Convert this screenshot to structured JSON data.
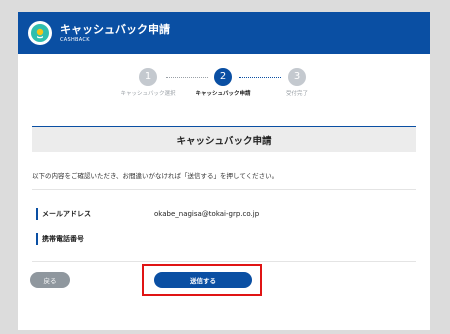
{
  "header": {
    "title": "キャッシュバック申請",
    "subtitle": "CASHBACK",
    "logo_icon": "coin-badge-icon"
  },
  "steps": [
    {
      "number": "1",
      "label": "キャッシュバック選択",
      "state": "done"
    },
    {
      "number": "2",
      "label": "キャッシュバック申請",
      "state": "active"
    },
    {
      "number": "3",
      "label": "受付完了",
      "state": "pending"
    }
  ],
  "section": {
    "title": "キャッシュバック申請"
  },
  "description": "以下の内容をご確認いただき、お間違いがなければ「送信する」を押してください。",
  "fields": [
    {
      "label": "メールアドレス",
      "value": "okabe_nagisa@tokai-grp.co.jp"
    },
    {
      "label": "携帯電話番号",
      "value": ""
    }
  ],
  "buttons": {
    "back_label": "戻る",
    "submit_label": "送信する"
  },
  "colors": {
    "brand": "#0a4fa3",
    "highlight": "#e01414",
    "inactive": "#c4c9cf"
  }
}
